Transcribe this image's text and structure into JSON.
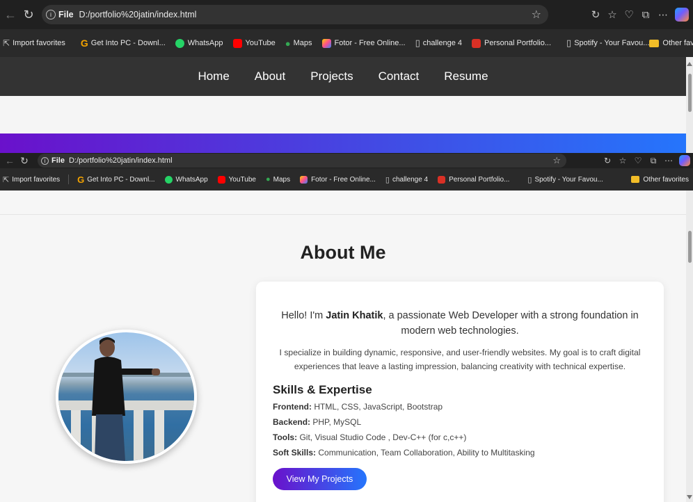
{
  "browser": {
    "address_label": "File",
    "url": "D:/portfolio%20jatin/index.html",
    "bookmarks": [
      {
        "label": "Import favorites",
        "icon": "import-icon"
      },
      {
        "label": "Get Into PC - Downl...",
        "icon": "getintopc-icon",
        "color": "#f4a300"
      },
      {
        "label": "WhatsApp",
        "icon": "whatsapp-icon",
        "color": "#25d366"
      },
      {
        "label": "YouTube",
        "icon": "youtube-icon",
        "color": "#ff0000"
      },
      {
        "label": "Maps",
        "icon": "maps-icon",
        "color": "#34a853"
      },
      {
        "label": "Fotor - Free Online...",
        "icon": "fotor-icon",
        "color": "#ff5b8c"
      },
      {
        "label": "challenge 4",
        "icon": "page-icon"
      },
      {
        "label": "Personal Portfolio...",
        "icon": "pdf-icon",
        "color": "#d93025"
      },
      {
        "label": "Spotify - Your Favou...",
        "icon": "page-icon"
      }
    ],
    "other_favorites": "Other favorites"
  },
  "nav": {
    "items": [
      "Home",
      "About",
      "Projects",
      "Contact",
      "Resume"
    ]
  },
  "about": {
    "title": "About Me",
    "intro_pre": "Hello! I'm ",
    "name": "Jatin Khatik",
    "intro_post": ", a passionate Web Developer with a strong foundation in modern web technologies.",
    "description": "I specialize in building dynamic, responsive, and user-friendly websites. My goal is to craft digital experiences that leave a lasting impression, balancing creativity with technical expertise.",
    "skills_title": "Skills & Expertise",
    "skills": [
      {
        "label": "Frontend:",
        "value": " HTML, CSS, JavaScript, Bootstrap"
      },
      {
        "label": "Backend:",
        "value": " PHP, MySQL"
      },
      {
        "label": "Tools:",
        "value": " Git, Visual Studio Code , Dev-C++ (for c,c++)"
      },
      {
        "label": "Soft Skills:",
        "value": " Communication, Team Collaboration, Ability to Multitasking"
      }
    ],
    "cta": "View My Projects"
  },
  "colors": {
    "gradient_start": "#6a11cb",
    "gradient_end": "#2575fc",
    "nav_bg": "#333333"
  }
}
